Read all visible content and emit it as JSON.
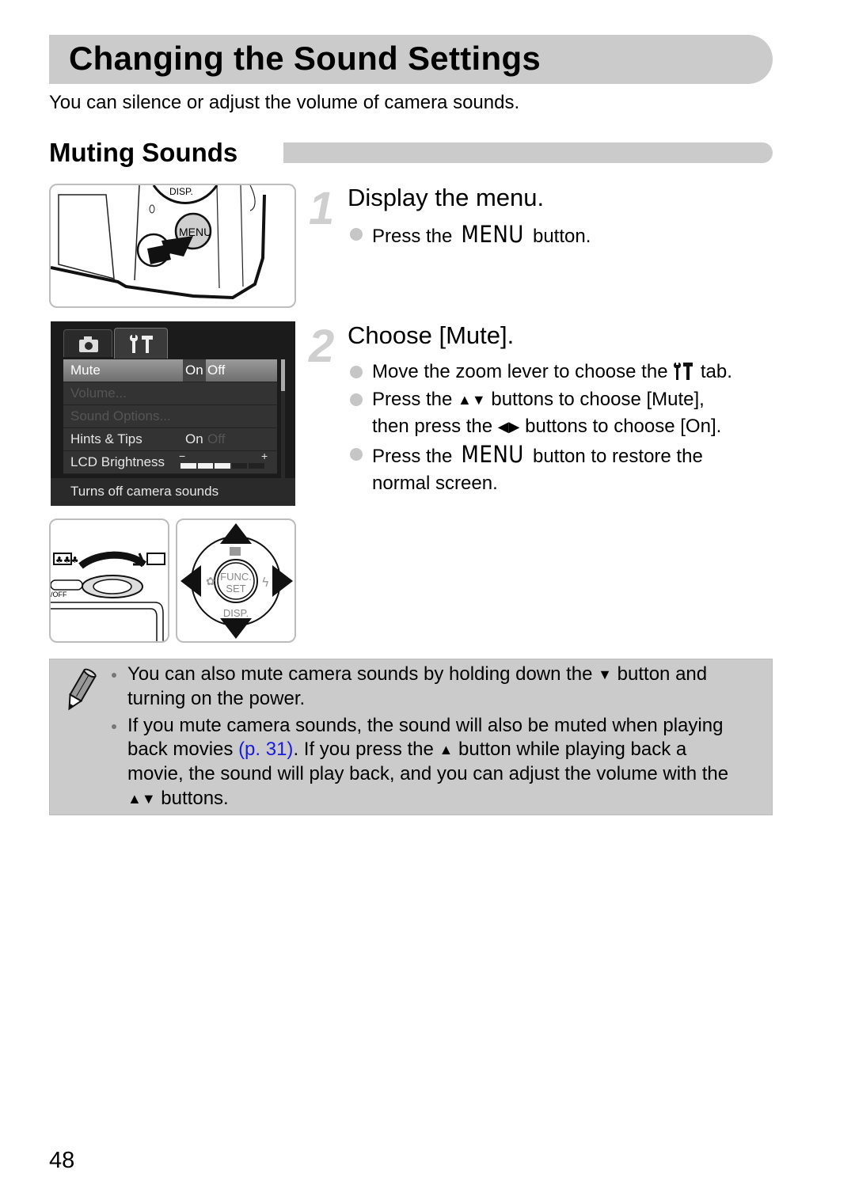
{
  "page": {
    "title": "Changing the Sound Settings",
    "intro": "You can silence or adjust the volume of camera sounds.",
    "section_heading": "Muting Sounds",
    "page_number": "48"
  },
  "steps": [
    {
      "number": "1",
      "title": "Display the menu.",
      "bullets": [
        {
          "pre": "Press the ",
          "key": "MENU",
          "post": " button."
        }
      ]
    },
    {
      "number": "2",
      "title": "Choose [Mute].",
      "bullets": [
        {
          "pre": "Move the zoom lever to choose the ",
          "icon": "wrench-hammer-tab-icon",
          "icon_glyph": "ƳT",
          "post": " tab."
        },
        {
          "line1_pre": "Press the ",
          "arrows1": "▲▼",
          "line1_post": " buttons to choose [Mute],",
          "line2_pre": "then press the ",
          "arrows2": "◀▶",
          "line2_post": " buttons to choose [On]."
        },
        {
          "pre": "Press the ",
          "key": "MENU",
          "post": " button to restore the",
          "line2": "normal screen."
        }
      ]
    }
  ],
  "camera_illustration": {
    "menu_button_label": "MENU",
    "disp_label": "DISP."
  },
  "lcd_menu": {
    "tabs": [
      {
        "name": "camera-tab",
        "glyph": "📷"
      },
      {
        "name": "settings-tab",
        "glyph": "ƳT",
        "selected": true
      }
    ],
    "rows": [
      {
        "label": "Mute",
        "value_on": "On",
        "value_off": "Off",
        "selected": true,
        "current": "On"
      },
      {
        "label": "Volume...",
        "disabled": true
      },
      {
        "label": "Sound Options...",
        "disabled": true
      },
      {
        "label": "Hints & Tips",
        "value_on": "On",
        "value_off": "Off",
        "current": "On"
      },
      {
        "label": "LCD Brightness",
        "slider_min": "−",
        "slider_max": "+",
        "level": 3,
        "level_max": 5
      }
    ],
    "help_text": "Turns off camera sounds"
  },
  "dial_illustration": {
    "center_line1": "FUNC.",
    "center_line2": "SET",
    "bottom_label": "DISP."
  },
  "zoom_lever_illustration": {
    "off_label": "/OFF"
  },
  "note": {
    "items": [
      {
        "l1_pre": "You can also mute camera sounds by holding down the ",
        "l1_arrow": "▼",
        "l1_post": " button and",
        "l2": "turning on the power."
      },
      {
        "l1": "If you mute camera sounds, the sound will also be muted when playing",
        "l2_pre": "back movies ",
        "l2_link": "(p. 31)",
        "l2_mid": ". If you press the ",
        "l2_arrow": "▲",
        "l2_post": " button while playing back a",
        "l3": "movie, the sound will play back, and you can adjust the volume with the",
        "l4_arrows": "▲▼",
        "l4_post": " buttons."
      }
    ]
  },
  "colors": {
    "header_gray": "#cbcbcb",
    "link_blue": "#1a1adb",
    "step_number_gray": "#cfcfcf"
  }
}
